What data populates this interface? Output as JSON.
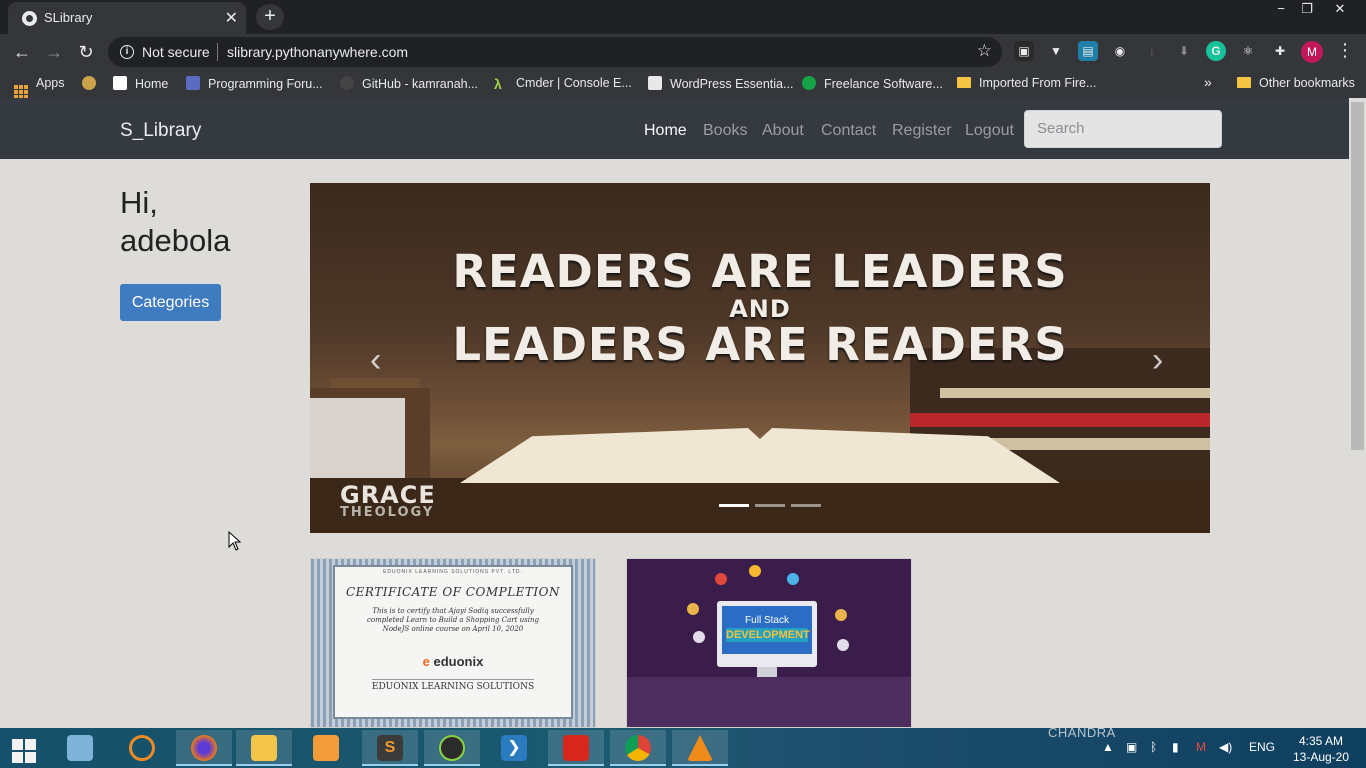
{
  "browser": {
    "tab_title": "SLibrary",
    "tab_close": "✕",
    "new_tab": "+",
    "window_controls": {
      "minimize": "−",
      "restore": "❐",
      "close": "✕"
    },
    "security_label": "Not secure",
    "url": "slibrary.pythonanywhere.com",
    "profile_initial": "M",
    "bookmarks": [
      {
        "label": "Apps",
        "icon": "apps-grid-icon"
      },
      {
        "label": "Home",
        "icon": "page-icon"
      },
      {
        "label": "Programming Foru...",
        "icon": "forum-icon"
      },
      {
        "label": "GitHub - kamranah...",
        "icon": "github-icon"
      },
      {
        "label": "Cmder | Console E...",
        "icon": "lambda-icon"
      },
      {
        "label": "WordPress Essentia...",
        "icon": "wordpress-icon"
      },
      {
        "label": "Freelance Software...",
        "icon": "freelance-icon"
      },
      {
        "label": "Imported From Fire...",
        "icon": "folder-icon"
      }
    ],
    "bookmarks_overflow": "»",
    "other_bookmarks": "Other bookmarks"
  },
  "site": {
    "brand": "S_Library",
    "nav": [
      {
        "label": "Home",
        "active": true
      },
      {
        "label": "Books",
        "active": false
      },
      {
        "label": "About",
        "active": false
      },
      {
        "label": "Contact",
        "active": false
      },
      {
        "label": "Register",
        "active": false
      },
      {
        "label": "Logout",
        "active": false
      }
    ],
    "search_placeholder": "Search",
    "greeting_line1": "Hi,",
    "greeting_line2": "adebola",
    "categories_button": "Categories",
    "carousel": {
      "line1": "READERS ARE LEADERS",
      "line2": "AND",
      "line3": "LEADERS ARE READERS",
      "watermark1": "GRACE",
      "watermark2": "THEOLOGY",
      "prev": "‹",
      "next": "›",
      "indicators": 3,
      "active_index": 0
    },
    "cards": [
      {
        "header": "EDUONIX LEARNING SOLUTIONS PVT. LTD.",
        "title": "CERTIFICATE OF COMPLETION",
        "body": "This is to certify that Ajayi Sodiq successfully completed Learn to Build a Shopping Cart using NodeJS online course on April 10, 2020",
        "logo": "eduonix",
        "footer": "EDUONIX LEARNING SOLUTIONS"
      },
      {
        "line1": "Full Stack",
        "line2": "DEVELOPMENT"
      }
    ]
  },
  "taskbar": {
    "language": "ENG",
    "time": "4:35 AM",
    "date": "13-Aug-20",
    "watermark": "CHANDRA",
    "apps": [
      "start",
      "server-manager",
      "sync",
      "firefox",
      "file-explorer",
      "media-player",
      "sublime-text",
      "android",
      "powershell",
      "acrobat",
      "chrome",
      "vlc"
    ]
  },
  "colors": {
    "navbar": "#343a40",
    "button_primary": "#3f7bbf",
    "page_bg": "#dedcd9",
    "chrome_dark": "#202124",
    "chrome_toolbar": "#35363a"
  }
}
